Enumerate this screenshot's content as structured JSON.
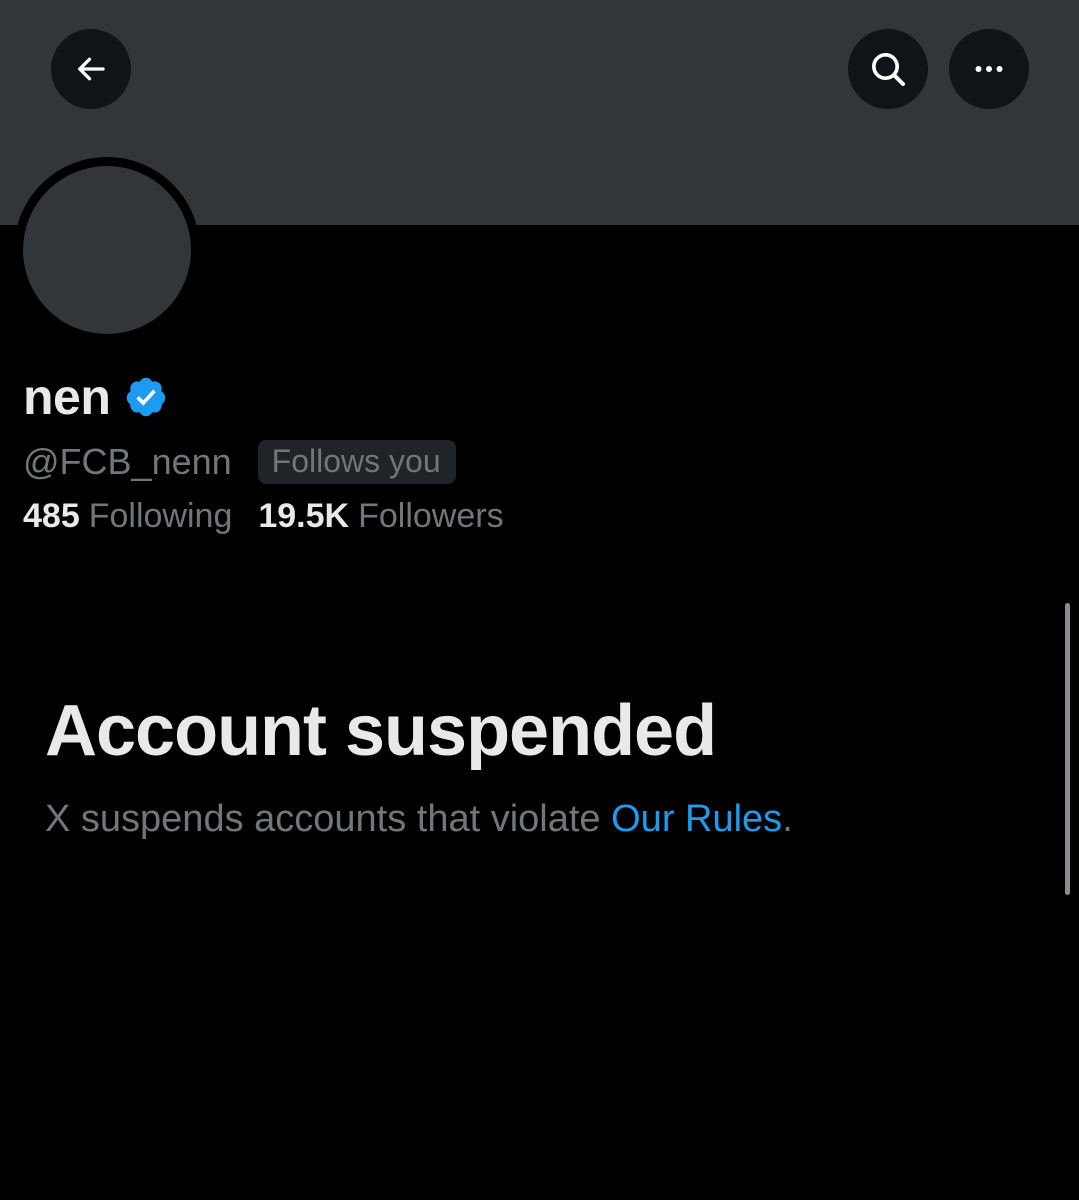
{
  "header": {
    "back_icon": "arrow-left-icon",
    "search_icon": "search-icon",
    "more_icon": "more-horizontal-icon"
  },
  "profile": {
    "display_name": "nen",
    "verified_icon": "verified-badge-icon",
    "handle": "@FCB_nenn",
    "follows_you": "Follows you",
    "following_count": "485",
    "following_label": "Following",
    "followers_count": "19.5K",
    "followers_label": "Followers"
  },
  "suspension": {
    "title": "Account suspended",
    "description_prefix": "X suspends accounts that violate ",
    "rules_link": "Our Rules",
    "description_suffix": "."
  },
  "colors": {
    "background": "#000000",
    "banner": "#333639",
    "primary_text": "#e7e9ea",
    "secondary_text": "#71767b",
    "link": "#1d9bf0",
    "verified": "#1d9bf0"
  }
}
